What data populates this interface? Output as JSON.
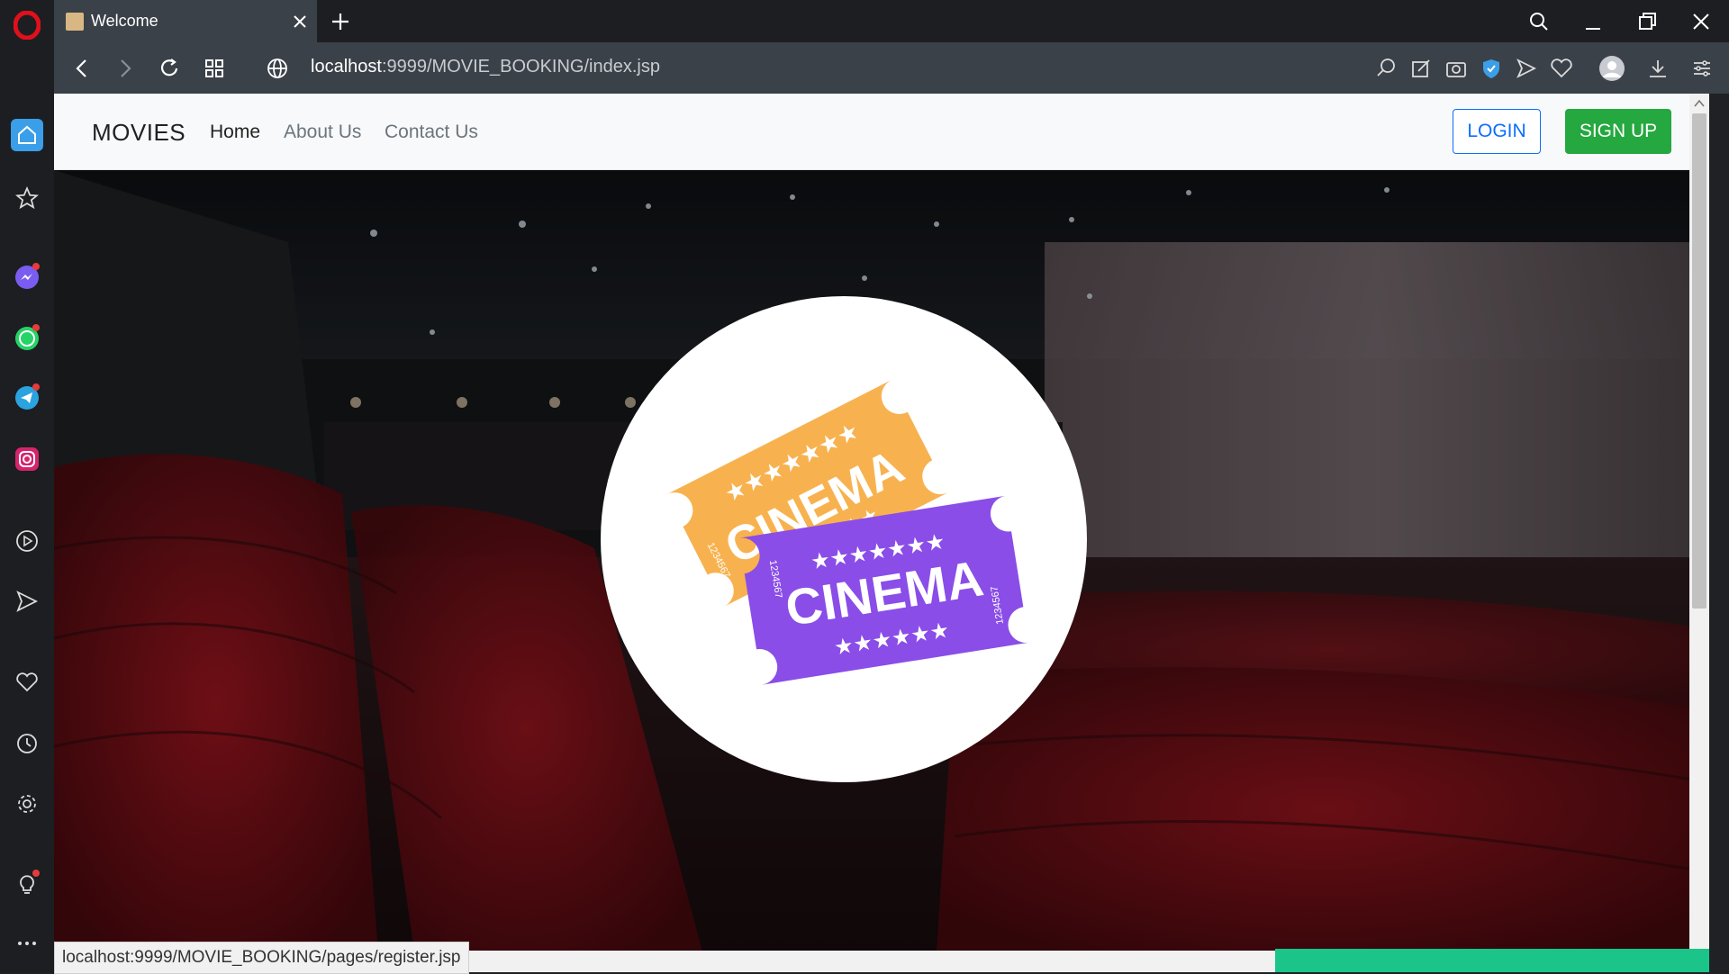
{
  "browser": {
    "tab": {
      "title": "Welcome"
    },
    "url": {
      "host": "localhost",
      "path": ":9999/MOVIE_BOOKING/index.jsp"
    },
    "status_link": "localhost:9999/MOVIE_BOOKING/pages/register.jsp"
  },
  "sidebar": {
    "items": [
      {
        "icon": "opera-logo-icon"
      },
      {
        "icon": "home-icon"
      },
      {
        "icon": "star-icon"
      },
      {
        "icon": "messenger-icon"
      },
      {
        "icon": "whatsapp-icon"
      },
      {
        "icon": "telegram-icon"
      },
      {
        "icon": "instagram-icon"
      },
      {
        "icon": "player-icon"
      },
      {
        "icon": "send-icon"
      },
      {
        "icon": "heart-icon"
      },
      {
        "icon": "history-icon"
      },
      {
        "icon": "settings-icon"
      },
      {
        "icon": "lightbulb-icon"
      },
      {
        "icon": "more-icon"
      }
    ]
  },
  "navbar": {
    "brand": "MOVIES",
    "links": [
      "Home",
      "About Us",
      "Contact Us"
    ],
    "login": "LOGIN",
    "signup": "SIGN UP"
  },
  "hero": {
    "ticket_back_text": "CINEMA",
    "ticket_front_text": "CINEMA",
    "ticket_serial": "1234567"
  },
  "colors": {
    "login": "#0d6efd",
    "signup": "#24a83f",
    "ticket_orange": "#f7b24f",
    "ticket_purple": "#8a4de8",
    "progress": "#1bc58a"
  }
}
